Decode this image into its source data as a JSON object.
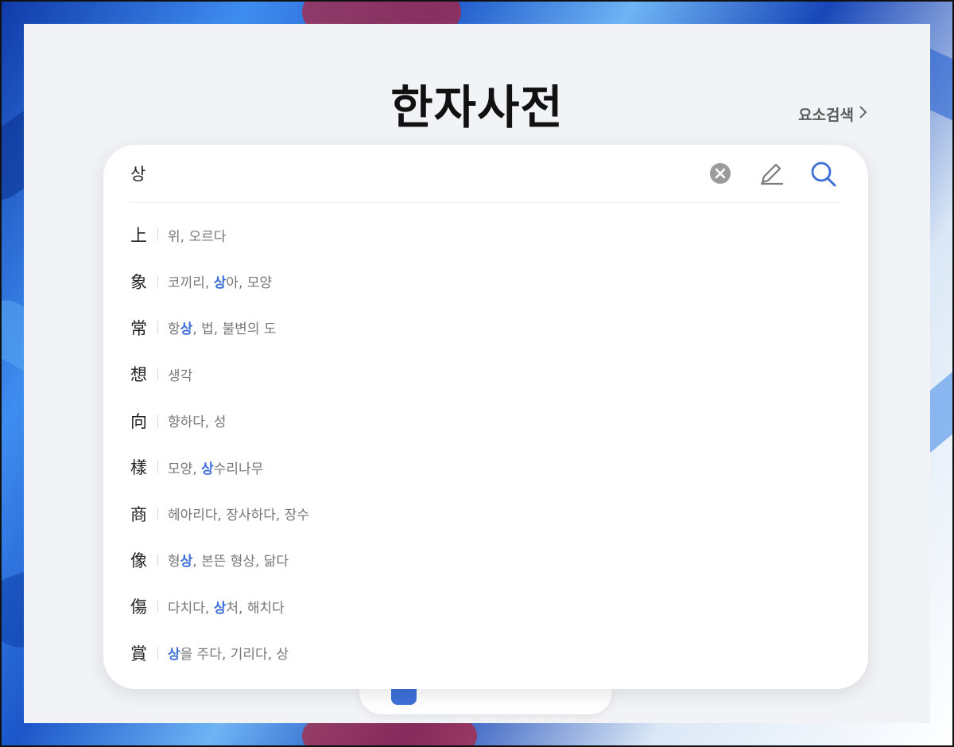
{
  "header": {
    "title": "한자사전",
    "element_search_label": "요소검색"
  },
  "search": {
    "query": "상"
  },
  "icons": {
    "clear": "clear-circle-icon",
    "handwriting": "pencil-icon",
    "search": "search-icon",
    "chevron": "chevron-right-icon"
  },
  "colors": {
    "accent": "#3d6fd8",
    "panel_bg": "#f2f3f7",
    "text_muted": "#777777"
  },
  "results": [
    {
      "hanja": "上",
      "pre": "위, 오르다",
      "hl": "",
      "post": ""
    },
    {
      "hanja": "象",
      "pre": "코끼리, ",
      "hl": "상",
      "post": "아, 모양"
    },
    {
      "hanja": "常",
      "pre": "항",
      "hl": "상",
      "post": ", 법, 불변의 도"
    },
    {
      "hanja": "想",
      "pre": "생각",
      "hl": "",
      "post": ""
    },
    {
      "hanja": "向",
      "pre": "향하다, 성",
      "hl": "",
      "post": ""
    },
    {
      "hanja": "樣",
      "pre": "모양, ",
      "hl": "상",
      "post": "수리나무"
    },
    {
      "hanja": "商",
      "pre": "헤아리다, 장사하다, 장수",
      "hl": "",
      "post": ""
    },
    {
      "hanja": "像",
      "pre": "형",
      "hl": "상",
      "post": ", 본뜬 형상, 닮다"
    },
    {
      "hanja": "傷",
      "pre": "다치다, ",
      "hl": "상",
      "post": "처, 해치다"
    },
    {
      "hanja": "賞",
      "pre": "",
      "hl": "상",
      "post": "을 주다, 기리다, 상"
    }
  ]
}
